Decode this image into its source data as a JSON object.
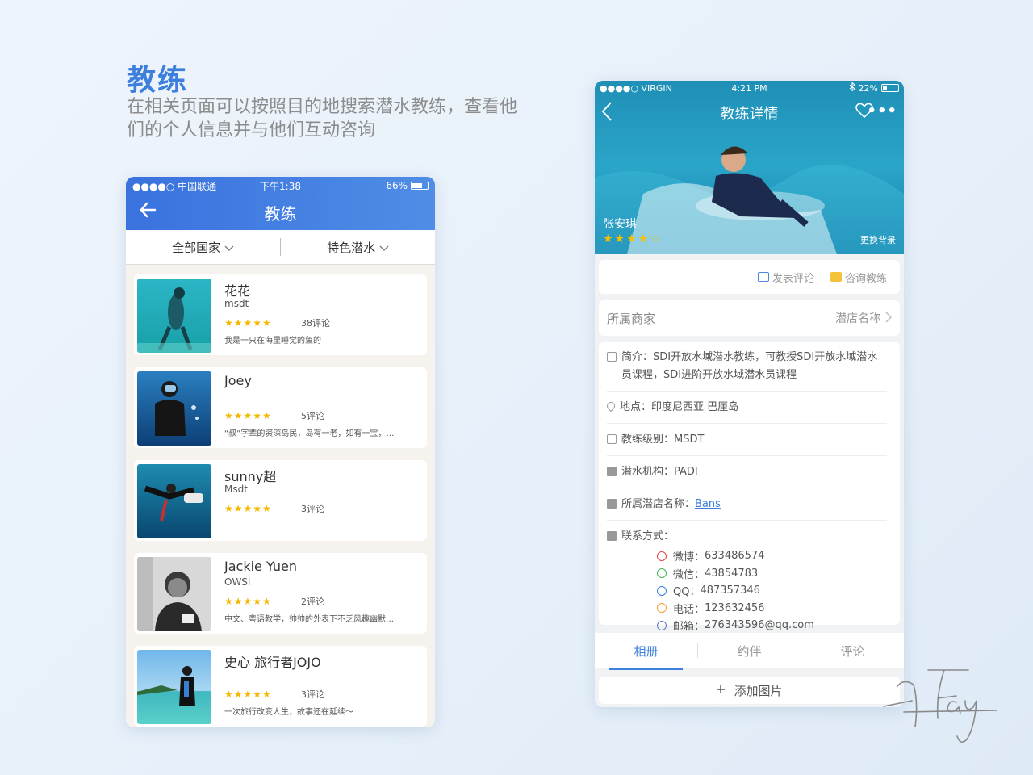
{
  "intro": {
    "title": "教练",
    "description": "在相关页面可以按照目的地搜索潜水教练，查看他们的个人信息并与他们互动咨询"
  },
  "left_phone": {
    "status": {
      "carrier": "●●●●○ 中国联通",
      "time": "下午1:38",
      "battery": "66%"
    },
    "nav": {
      "back_icon": "arrow-left-icon",
      "title": "教练"
    },
    "filters": [
      "全部国家",
      "特色潜水"
    ],
    "coaches": [
      {
        "name": "花花",
        "level": "msdt",
        "stars": "★★★★★",
        "reviews": "38评论",
        "bio": "我是一只在海里睡觉的鱼的"
      },
      {
        "name": "Joey",
        "level": "",
        "stars": "★★★★★",
        "reviews": "5评论",
        "bio": "“叔”字辈的资深岛民，岛有一老，如有一宝，…"
      },
      {
        "name": "sunny超",
        "level": "Msdt",
        "stars": "★★★★★",
        "reviews": "3评论",
        "bio": ""
      },
      {
        "name": "Jackie Yuen",
        "level": "OWSI",
        "stars": "★★★★★",
        "reviews": "2评论",
        "bio": "中文、粤语教学，帅帅的外表下不乏风趣幽默…"
      },
      {
        "name": "史心 旅行者JOJO",
        "level": "",
        "stars": "★★★★★",
        "reviews": "3评论",
        "bio": "一次旅行改变人生，故事还在延续～"
      }
    ]
  },
  "right_phone": {
    "status": {
      "carrier": "●●●●○ VIRGIN",
      "time": "4:21 PM",
      "battery": "22%"
    },
    "nav": {
      "title": "教练详情",
      "more": "•••"
    },
    "coach_name": "张安琪",
    "stars": "★★★★",
    "star_empty": "☆",
    "change_bg": "更换背景",
    "actions": {
      "comment": "发表评论",
      "consult": "咨询教练"
    },
    "shop": {
      "label": "所属商家",
      "value": "潜店名称"
    },
    "info": {
      "intro_key": "简介：",
      "intro": "SDI开放水域潜水教练，可教授SDI开放水域潜水员课程，SDI进阶开放水域潜水员课程",
      "location_key": "地点：",
      "location": "印度尼西亚  巴厘岛",
      "level_key": "教练级别：",
      "level": "MSDT",
      "org_key": "潜水机构：",
      "org": "PADI",
      "shop_key": "所属潜店名称：",
      "shop": "Bans",
      "contact_key": "联系方式："
    },
    "contacts": [
      {
        "label": "微博：",
        "value": "633486574",
        "color": "#e2473f"
      },
      {
        "label": "微信：",
        "value": "43854783",
        "color": "#3fb34f"
      },
      {
        "label": "QQ：",
        "value": "487357346",
        "color": "#3a7de0"
      },
      {
        "label": "电话：",
        "value": "123632456",
        "color": "#f0a030"
      },
      {
        "label": "邮箱：",
        "value": "276343596@qq.com",
        "color": "#5a7ac8"
      }
    ],
    "tabs": [
      "相册",
      "约伴",
      "评论"
    ],
    "add_photo": "添加图片"
  },
  "colors": {
    "accent": "#3d7fdc",
    "star": "#f5b800"
  }
}
